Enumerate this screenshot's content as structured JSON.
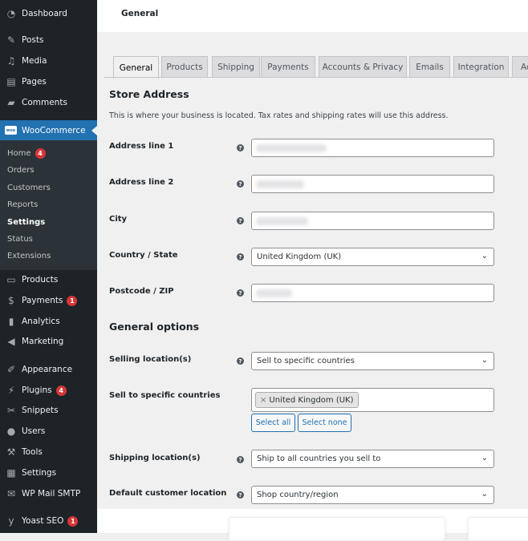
{
  "sidebar": {
    "items": [
      {
        "label": "Dashboard",
        "icon": "dashboard-icon"
      },
      {
        "label": "Posts",
        "icon": "pin-icon"
      },
      {
        "label": "Media",
        "icon": "media-icon"
      },
      {
        "label": "Pages",
        "icon": "pages-icon"
      },
      {
        "label": "Comments",
        "icon": "comment-icon"
      }
    ],
    "woocommerce": {
      "label": "WooCommerce",
      "logo": "woo",
      "submenu": [
        {
          "label": "Home",
          "badge": "4"
        },
        {
          "label": "Orders"
        },
        {
          "label": "Customers"
        },
        {
          "label": "Reports"
        },
        {
          "label": "Settings",
          "current": true
        },
        {
          "label": "Status"
        },
        {
          "label": "Extensions"
        }
      ]
    },
    "items2": [
      {
        "label": "Products",
        "icon": "archive-icon"
      },
      {
        "label": "Payments",
        "icon": "dollar-icon",
        "badge": "1"
      },
      {
        "label": "Analytics",
        "icon": "bar-chart-icon"
      },
      {
        "label": "Marketing",
        "icon": "megaphone-icon"
      },
      {
        "label": "Appearance",
        "icon": "brush-icon"
      },
      {
        "label": "Plugins",
        "icon": "plug-icon",
        "badge": "4"
      },
      {
        "label": "Snippets",
        "icon": "scissors-icon"
      },
      {
        "label": "Users",
        "icon": "user-icon"
      },
      {
        "label": "Tools",
        "icon": "wrench-icon"
      },
      {
        "label": "Settings",
        "icon": "sliders-icon"
      },
      {
        "label": "WP Mail SMTP",
        "icon": "mail-icon"
      },
      {
        "label": "Yoast SEO",
        "icon": "yoast-icon",
        "badge": "1"
      }
    ]
  },
  "header": {
    "title": "General"
  },
  "tabs": [
    "General",
    "Products",
    "Shipping",
    "Payments",
    "Accounts & Privacy",
    "Emails",
    "Integration",
    "Ad"
  ],
  "store_address": {
    "heading": "Store Address",
    "description": "This is where your business is located. Tax rates and shipping rates will use this address.",
    "address1_label": "Address line 1",
    "address2_label": "Address line 2",
    "city_label": "City",
    "country_label": "Country / State",
    "country_value": "United Kingdom (UK)",
    "postcode_label": "Postcode / ZIP"
  },
  "general_options": {
    "heading": "General options",
    "selling_label": "Selling location(s)",
    "selling_value": "Sell to specific countries",
    "specific_label": "Sell to specific countries",
    "chip_remove": "×",
    "chip_value": "United Kingdom (UK)",
    "select_all": "Select all",
    "select_none": "Select none",
    "shipping_label": "Shipping location(s)",
    "shipping_value": "Ship to all countries you sell to",
    "default_label": "Default customer location",
    "default_value": "Shop country/region"
  },
  "help_glyph": "?",
  "chevron_glyph": "⌄",
  "colors": {
    "accent": "#2271b1",
    "sidebar": "#1d2327",
    "badge": "#d63638"
  }
}
